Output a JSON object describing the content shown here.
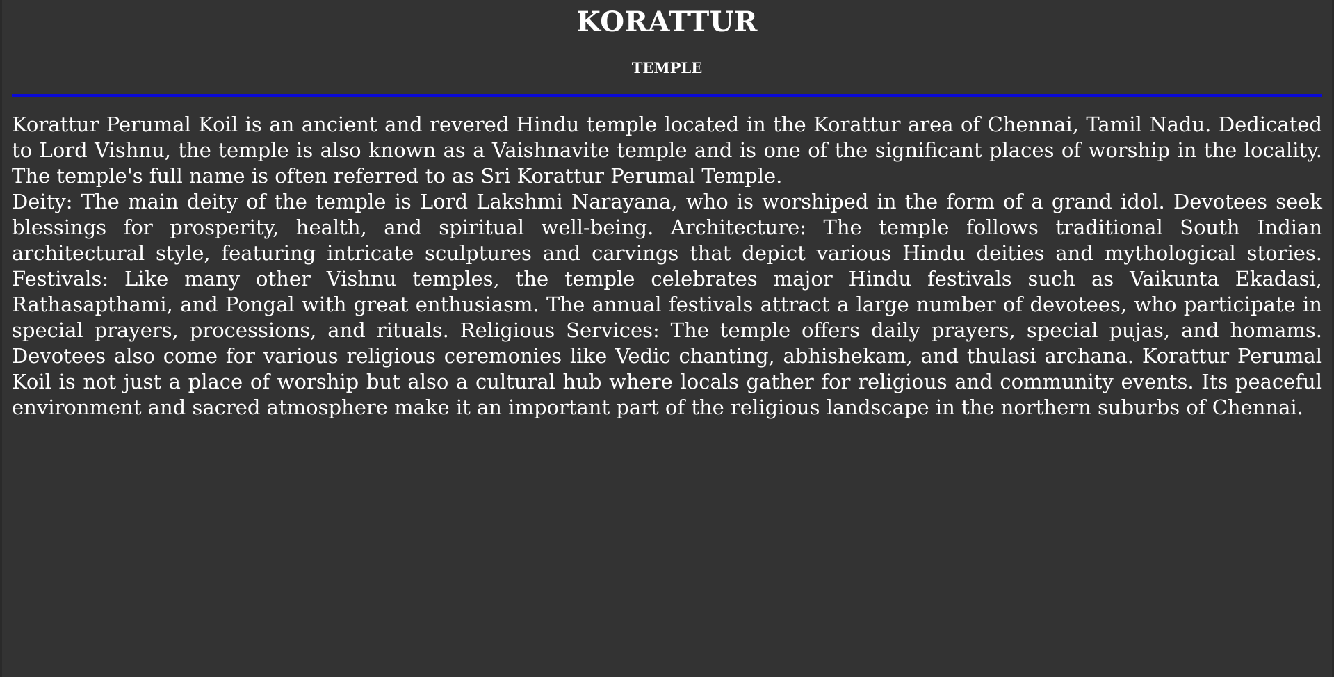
{
  "header": {
    "title": "KORATTUR",
    "subtitle": "TEMPLE"
  },
  "colors": {
    "background": "#333333",
    "text": "#ffffff",
    "divider": "#0a0ad6"
  },
  "content": {
    "paragraphs": [
      "Korattur Perumal Koil is an ancient and revered Hindu temple located in the Korattur area of Chennai, Tamil Nadu. Dedicated to Lord Vishnu, the temple is also known as a Vaishnavite temple and is one of the significant places of worship in the locality. The temple's full name is often referred to as Sri Korattur Perumal Temple.",
      "Deity: The main deity of the temple is Lord Lakshmi Narayana, who is worshiped in the form of a grand idol. Devotees seek blessings for prosperity, health, and spiritual well-being. Architecture: The temple follows traditional South Indian architectural style, featuring intricate sculptures and carvings that depict various Hindu deities and mythological stories. Festivals: Like many other Vishnu temples, the temple celebrates major Hindu festivals such as Vaikunta Ekadasi, Rathasapthami, and Pongal with great enthusiasm. The annual festivals attract a large number of devotees, who participate in special prayers, processions, and rituals. Religious Services: The temple offers daily prayers, special pujas, and homams. Devotees also come for various religious ceremonies like Vedic chanting, abhishekam, and thulasi archana. Korattur Perumal Koil is not just a place of worship but also a cultural hub where locals gather for religious and community events. Its peaceful environment and sacred atmosphere make it an important part of the religious landscape in the northern suburbs of Chennai."
    ]
  }
}
